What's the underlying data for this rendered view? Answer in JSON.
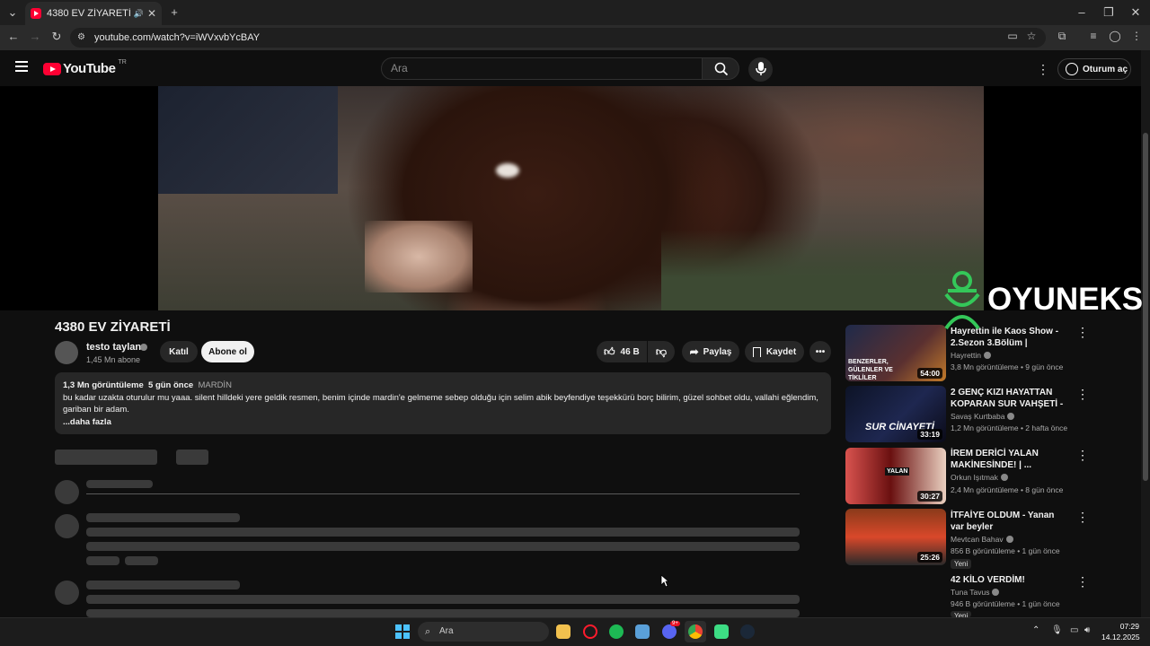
{
  "browser": {
    "tab_title": "4380 EV ZİYARETİ - YouTube",
    "url": "youtube.com/watch?v=iWVxvbYcBAY"
  },
  "masthead": {
    "logo_text": "YouTube",
    "country": "TR",
    "search_placeholder": "Ara",
    "signin_label": "Oturum aç"
  },
  "watermark": {
    "text": "OYUNEKS"
  },
  "video": {
    "title": "4380 EV ZİYARETİ",
    "channel": "testo taylan",
    "subscribers": "1,45 Mn abone",
    "join_label": "Katıl",
    "subscribe_label": "Abone ol",
    "likes": "46 B",
    "share_label": "Paylaş",
    "save_label": "Kaydet"
  },
  "description": {
    "views": "1,3 Mn görüntüleme",
    "date": "5 gün önce",
    "location": "MARDİN",
    "text": "bu kadar uzakta oturulur mu yaaa. silent hilldeki yere geldik resmen, benim içinde mardin'e gelmeme sebep olduğu için selim abik beyfendiye teşekkürü borç bilirim, güzel sohbet oldu, vallahi eğlendim, gariban bir adam.",
    "more_label": "...daha fazla"
  },
  "related": [
    {
      "title": "Hayrettin ile Kaos Show - 2.Sezon 3.Bölüm | Benzerler, ...",
      "channel": "Hayrettin",
      "meta": "3,8 Mn görüntüleme • 9 gün önce",
      "duration": "54:00",
      "thumb_text": "BENZERLER, GÜLENLER VE TİKLİLER",
      "badge": ""
    },
    {
      "title": "2 GENÇ KIZI HAYATTAN KOPARAN SUR VAHŞETİ - ...",
      "channel": "Savaş Kurtbaba",
      "meta": "1,2 Mn görüntüleme • 2 hafta önce",
      "duration": "33:19",
      "thumb_text": "SUR CİNAYETİ",
      "badge": ""
    },
    {
      "title": "İREM DERİCİ YALAN MAKİNESİNDE! | ...",
      "channel": "Orkun Işıtmak",
      "meta": "2,4 Mn görüntüleme • 8 gün önce",
      "duration": "30:27",
      "thumb_text": "YALAN",
      "badge": ""
    },
    {
      "title": "İTFAİYE OLDUM - Yanan var beyler",
      "channel": "Mevtcan Bahav",
      "meta": "856 B görüntüleme • 1 gün önce",
      "duration": "25:26",
      "thumb_text": "",
      "badge": "Yeni"
    },
    {
      "title": "42 KİLO VERDİM!",
      "channel": "Tuna Tavus",
      "meta": "946 B görüntüleme • 1 gün önce",
      "duration": "",
      "thumb_text": "",
      "badge": "Yeni"
    }
  ],
  "taskbar": {
    "search_label": "Ara",
    "time": "07:29",
    "date": "14.12.2025",
    "discord_badge": "9+"
  },
  "colors": {
    "yt_red": "#ff0033",
    "bg": "#0f0f0f",
    "surface": "#272727",
    "watermark_green": "#34c759"
  }
}
